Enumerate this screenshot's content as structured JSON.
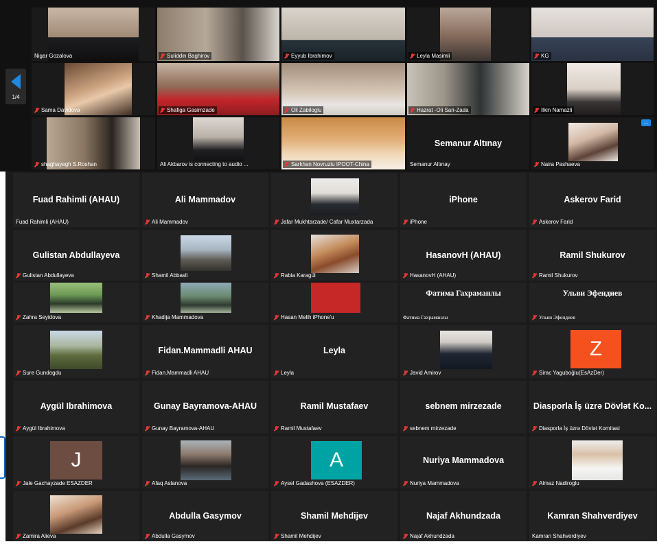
{
  "page_indicator": "1/4",
  "corner_button_glyph": "...",
  "video_tiles": {
    "nigar": "Nigar Gozalova",
    "sukhdin": "Suliddin Baghirov",
    "eyyub": "Eyyub Ibrahimov",
    "leyla_masimli": "Leyla Masimli",
    "kg": "KG",
    "sama": "Sama Davidova",
    "shafiga": "Shafiga Gasimzade",
    "oli": "Oli Zabiloglu",
    "hazrat": "Hazrat -Oli Sari-Zada",
    "ilkin": "Ilkin Namazli",
    "shaghayegh": "shaghayegh S.Roshan",
    "ali_akbarov": "Ali Akbarov is connecting to audio ...",
    "sarkhan": "Sarkhan Novruzlu IPOOT-China",
    "semanur_big": "Semanur Altınay",
    "semanur": "Semanur Altınay",
    "naira": "Naira Pashaeva"
  },
  "grid": {
    "fuad_big": "Fuad Rahimli (AHAU)",
    "fuad": "Fuad Rahimli (AHAU)",
    "ali_mammadov_big": "Ali Mammadov",
    "ali_mammadov": "Ali Mammadov",
    "jafar": "Jafar Mukhtarzade/ Cafar Muxtarzada",
    "iphone_big": "iPhone",
    "iphone": "iPhone",
    "askerov_big": "Askerov Farid",
    "askerov": "Askerov Farid",
    "gulistan_big": "Gulistan Abdullayeva",
    "gulistan": "Gulistan Abdullayeva",
    "shamil_abbasli": "Shamil Abbasli",
    "rabia": "Rabia Karagül",
    "hasanovh_big": "HasanovH (AHAU)",
    "hasanovh": "HasanovH (AHAU)",
    "ramil_shukurov_big": "Ramil Shukurov",
    "ramil_shukurov": "Ramil Shukurov",
    "zahra": "Zahra Seyidova",
    "khadija": "Khadija Mammadova",
    "hasan_melih": "Hasan Melih iPhone'u",
    "fatima_big": "Фатима Гахраманлы",
    "fatima": "Фатима Гахраманлы",
    "ulyan_big": "Ульви Эфендиев",
    "ulyan": "Ульви Эфендиев",
    "sure": "Sure Gundogdu",
    "fidan_big": "Fidan.Mammadli AHAU",
    "fidan": "Fidan.Mammadli AHAU",
    "leyla_big": "Leyla",
    "leyla": "Leyla",
    "javid": "Javid Amirov",
    "sirac_letter": "Z",
    "sirac": "Sirac Yaguboğlu(EsAzDer)",
    "aygul_big": "Aygül Ibrahimova",
    "aygul": "Aygül Ibrahimova",
    "gunay_big": "Gunay Bayramova-AHAU",
    "gunay": "Gunay Bayramova-AHAU",
    "ramil_m_big": "Ramil Mustafaev",
    "ramil_m": "Ramil Mustafaev",
    "sebnem_big": "sebnem mirzezade",
    "sebnem": "sebnem mirzezade",
    "diaspora_big": "Diasporla İş üzrə Dövlət Ko...",
    "diaspora": "Diasporla İş üzrə Dövlət Komitasi",
    "jale_letter": "J",
    "jale": "Jale Gachayzade ESAZDER",
    "afaq": "Afaq Aslanova",
    "aysel_letter": "A",
    "aysel": "Aysel Gadashova (ESAZDER)",
    "nuriya_big": "Nuriya Mammadova",
    "nuriya": "Nuriya Mammadova",
    "almaz": "Almaz Nadiroglu",
    "zamira": "Zamira Alieva",
    "abdulla_big": "Abdulla Gasymov",
    "abdulla": "Abdulla Gasymov",
    "shamil_m_big": "Shamil Mehdijev",
    "shamil_m": "Shamil Mehdijev",
    "najaf_big": "Najaf Akhundzada",
    "najaf": "Najaf Akhundzada",
    "kamran_big": "Kamran Shahverdiyev",
    "kamran": "Kamran Shahverdiyev"
  },
  "colors": {
    "tile_bg": "#222222",
    "muted_mic": "#e53935",
    "accent_blue": "#1e88e5",
    "sirac_avatar": "#f4511e",
    "jale_avatar": "#6d4c41",
    "aysel_avatar": "#00a3a3"
  }
}
